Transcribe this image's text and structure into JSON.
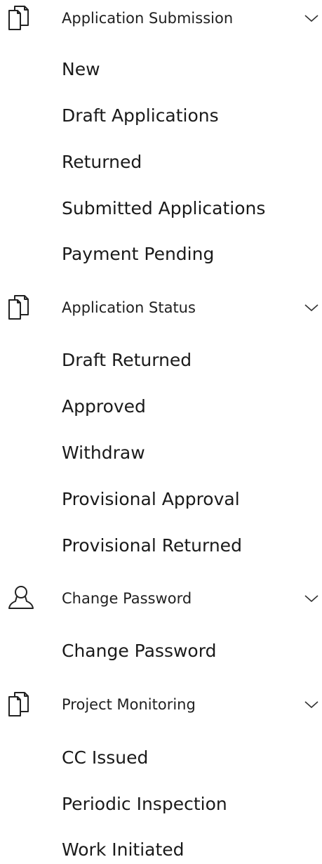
{
  "sections": [
    {
      "title": "Application Submission",
      "icon": "document-icon",
      "items": [
        "New",
        "Draft Applications",
        "Returned",
        "Submitted Applications",
        "Payment Pending"
      ]
    },
    {
      "title": "Application Status",
      "icon": "document-icon",
      "items": [
        "Draft Returned",
        "Approved",
        "Withdraw",
        "Provisional Approval",
        "Provisional Returned"
      ]
    },
    {
      "title": "Change Password",
      "icon": "user-icon",
      "items": [
        "Change Password"
      ]
    },
    {
      "title": "Project Monitoring",
      "icon": "document-icon",
      "items": [
        "CC Issued",
        "Periodic Inspection",
        "Work Initiated"
      ]
    }
  ],
  "colors": {
    "text": "#1a1a1a",
    "icon_stroke": "#222222",
    "background": "#ffffff"
  }
}
